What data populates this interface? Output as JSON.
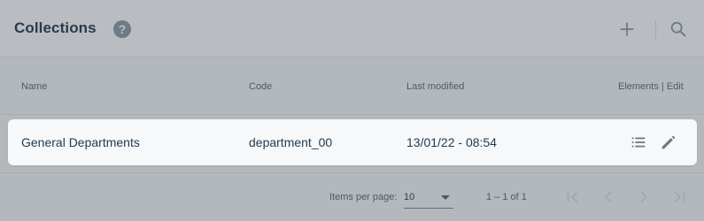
{
  "header": {
    "title": "Collections",
    "help_glyph": "?",
    "icons": [
      "help-icon",
      "add-icon",
      "search-icon"
    ]
  },
  "table": {
    "columns": {
      "name": "Name",
      "code": "Code",
      "last_modified": "Last modified",
      "actions": "Elements | Edit"
    },
    "rows": [
      {
        "name": "General Departments",
        "code": "department_00",
        "last_modified": "13/01/22 - 08:54",
        "action_icons": [
          "list-icon",
          "edit-icon"
        ]
      }
    ]
  },
  "paginator": {
    "items_per_page_label": "Items per page:",
    "items_per_page_value": "10",
    "range_label": "1 – 1 of 1",
    "icons": [
      "first-page-icon",
      "previous-page-icon",
      "next-page-icon",
      "last-page-icon"
    ]
  },
  "colors": {
    "background": "#b3b8bc",
    "row_background": "#f6f8fa",
    "text": "#1f3a52",
    "icon": "#6d7a87"
  }
}
